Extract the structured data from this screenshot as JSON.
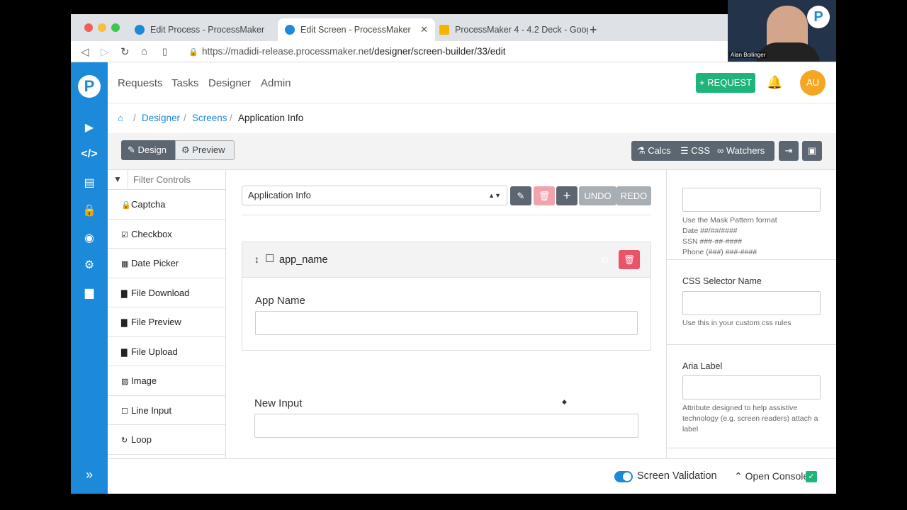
{
  "browser": {
    "tabs": [
      {
        "title": "Edit Process - ProcessMaker"
      },
      {
        "title": "Edit Screen - ProcessMaker"
      },
      {
        "title": "ProcessMaker 4 - 4.2 Deck - Goog"
      }
    ],
    "url_host": "https://madidi-release.processmaker.net",
    "url_path": "/designer/screen-builder/33/edit"
  },
  "topnav": {
    "menu": [
      "Requests",
      "Tasks",
      "Designer",
      "Admin"
    ],
    "request_button": "+ REQUEST",
    "avatar": "AU"
  },
  "breadcrumb": {
    "items": [
      "Designer",
      "Screens"
    ],
    "current": "Application Info"
  },
  "toolbar": {
    "design": "Design",
    "preview": "Preview",
    "calcs": "Calcs",
    "css": "CSS",
    "watchers": "Watchers"
  },
  "controls": {
    "filter_placeholder": "Filter Controls",
    "items": [
      {
        "label": "Captcha",
        "icon": "lock-icon"
      },
      {
        "label": "Checkbox",
        "icon": "checkbox-icon"
      },
      {
        "label": "Date Picker",
        "icon": "calendar-icon"
      },
      {
        "label": "File Download",
        "icon": "file-download-icon"
      },
      {
        "label": "File Preview",
        "icon": "file-preview-icon"
      },
      {
        "label": "File Upload",
        "icon": "file-upload-icon"
      },
      {
        "label": "Image",
        "icon": "image-icon"
      },
      {
        "label": "Line Input",
        "icon": "square-icon"
      },
      {
        "label": "Loop",
        "icon": "loop-icon"
      }
    ]
  },
  "canvas": {
    "page_select": "Application Info",
    "undo": "UNDO",
    "redo": "REDO",
    "selected_field": {
      "name": "app_name",
      "label": "App Name"
    },
    "field2_label": "New Input"
  },
  "inspector": {
    "mask_help": [
      "Use the Mask Pattern format",
      "Date ##/##/####",
      "SSN ###-##-####",
      "Phone (###) ###-####"
    ],
    "css_selector_label": "CSS Selector Name",
    "css_selector_help": "Use this in your custom css rules",
    "aria_label": "Aria Label",
    "aria_help": "Attribute designed to help assistive technology (e.g. screen readers) attach a label"
  },
  "bottom": {
    "validation": "Screen Validation",
    "console": "Open Console"
  },
  "video": {
    "name": "Alan Bollinger"
  },
  "colors": {
    "brand": "#1c8ad9",
    "success": "#1eb47a",
    "danger": "#e95468",
    "dark_button": "#5b6670",
    "avatar": "#f5a623"
  }
}
